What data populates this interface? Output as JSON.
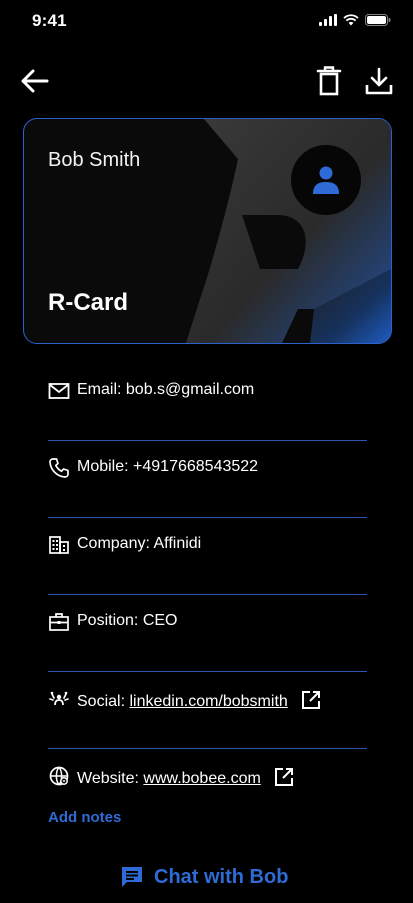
{
  "status_bar": {
    "time": "9:41",
    "icons": [
      "signal-icon",
      "wifi-icon",
      "battery-icon"
    ]
  },
  "topbar": {
    "icons": [
      "back-arrow-icon",
      "trash-icon",
      "download-icon"
    ]
  },
  "card": {
    "name": "Bob Smith",
    "title": "R-Card",
    "avatar_icon": "person-icon"
  },
  "info": {
    "email": {
      "label": "Email:",
      "value": "bob.s@gmail.com",
      "icon": "mail-icon"
    },
    "mobile": {
      "label": "Mobile:",
      "value": "+4917668543522",
      "icon": "phone-icon"
    },
    "company": {
      "label": "Company:",
      "value": "Affinidi",
      "icon": "building-icon"
    },
    "position": {
      "label": "Position:",
      "value": "CEO",
      "icon": "briefcase-icon"
    },
    "social": {
      "label": "Social:",
      "value": "linkedin.com/bobsmith",
      "icon": "social-icon"
    },
    "website": {
      "label": "Website:",
      "value": "www.bobee.com",
      "icon": "globe-icon"
    }
  },
  "actions": {
    "add_notes": "Add notes",
    "chat": "Chat with Bob",
    "chat_icon": "chat-icon"
  },
  "colors": {
    "accent": "#2f6bd6",
    "divider": "#2a55b3",
    "card_border": "#2b61c9",
    "background": "#000000"
  }
}
